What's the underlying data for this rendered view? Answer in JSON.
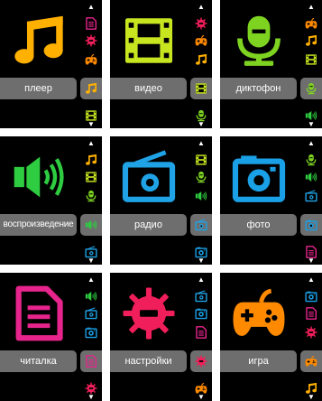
{
  "arrows": {
    "up": "▲",
    "down": "▼"
  },
  "colors": {
    "music": "#ffb000",
    "video": "#c8e620",
    "dictaphone": "#7ed321",
    "speaker": "#2ecc40",
    "radio": "#1fa3e6",
    "photo": "#1aa0e6",
    "reader": "#e6248c",
    "settings": "#f01e5a",
    "game": "#ff8a00"
  },
  "screens": [
    {
      "label": "плеер",
      "big_icon": "music-note-icon",
      "side_icons": [
        "reader-icon",
        "settings-gear-icon",
        "gamepad-icon",
        "music-note-icon",
        "video-film-icon"
      ]
    },
    {
      "label": "видео",
      "big_icon": "video-film-icon",
      "side_icons": [
        "settings-gear-icon",
        "gamepad-icon",
        "music-note-icon",
        "video-film-icon",
        "dictaphone-mic-icon"
      ]
    },
    {
      "label": "диктофон",
      "big_icon": "dictaphone-mic-icon",
      "side_icons": [
        "gamepad-icon",
        "music-note-icon",
        "video-film-icon",
        "dictaphone-mic-icon",
        "speaker-icon"
      ]
    },
    {
      "label": "воспроизведение",
      "big_icon": "speaker-icon",
      "side_icons": [
        "music-note-icon",
        "video-film-icon",
        "dictaphone-mic-icon",
        "speaker-icon",
        "radio-icon"
      ]
    },
    {
      "label": "радио",
      "big_icon": "radio-icon",
      "side_icons": [
        "video-film-icon",
        "dictaphone-mic-icon",
        "speaker-icon",
        "radio-icon",
        "camera-icon"
      ]
    },
    {
      "label": "фото",
      "big_icon": "camera-icon",
      "side_icons": [
        "dictaphone-mic-icon",
        "speaker-icon",
        "radio-icon",
        "camera-icon",
        "reader-icon"
      ]
    },
    {
      "label": "читалка",
      "big_icon": "reader-icon",
      "side_icons": [
        "speaker-icon",
        "radio-icon",
        "camera-icon",
        "reader-icon",
        "settings-gear-icon"
      ]
    },
    {
      "label": "настройки",
      "big_icon": "settings-gear-icon",
      "side_icons": [
        "radio-icon",
        "camera-icon",
        "reader-icon",
        "settings-gear-icon",
        "gamepad-icon"
      ]
    },
    {
      "label": "игра",
      "big_icon": "gamepad-icon",
      "side_icons": [
        "camera-icon",
        "reader-icon",
        "settings-gear-icon",
        "gamepad-icon",
        "music-note-icon"
      ]
    }
  ]
}
